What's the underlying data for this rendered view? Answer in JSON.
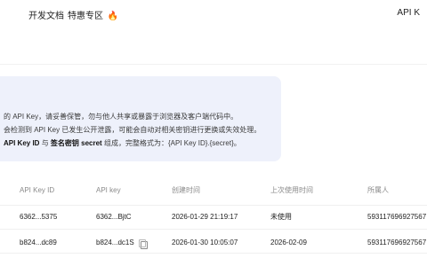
{
  "nav": {
    "docs": "开发文档",
    "promo": "特惠专区",
    "promo_icon": "fire-icon",
    "right_text": "API K"
  },
  "notice": {
    "line1": "的 API Key，请妥善保管，勿与他人共享或暴露于浏览器及客户端代码中。",
    "line2": "会检测到 API Key 已发生公开泄露，可能会自动对相关密钥进行更换或失效处理。",
    "line3_prefix": "API Key ID",
    "line3_mid": " 与 ",
    "line3_bold2": "签名密钥 secret",
    "line3_suffix": " 组成，完整格式为：{API Key ID}.{secret}。"
  },
  "table": {
    "headers": [
      "API Key ID",
      "API key",
      "创建时间",
      "上次使用时间",
      "所属人"
    ],
    "rows": [
      {
        "api_key_id": "6362...5375",
        "api_key": "6362...BjtC",
        "created": "2026-01-29 21:19:17",
        "last_used": "未使用",
        "owner": "593117696927567"
      },
      {
        "api_key_id": "b824...dc89",
        "api_key": "b824...dc1S",
        "created": "2026-01-30 10:05:07",
        "last_used": "2026-02-09",
        "owner": "593117696927567"
      }
    ]
  },
  "colors": {
    "notice_bg": "#eef1fb",
    "flame": "#ff6a00"
  }
}
